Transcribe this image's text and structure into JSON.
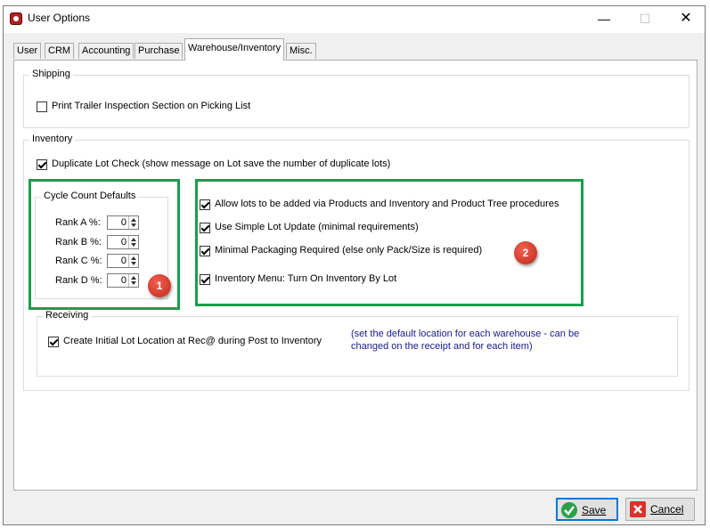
{
  "window": {
    "title": "User Options",
    "minimize_glyph": "—",
    "maximize_glyph": "☐",
    "close_glyph": "✕"
  },
  "tabs": [
    {
      "label": "User"
    },
    {
      "label": "CRM"
    },
    {
      "label": "Accounting"
    },
    {
      "label": "Purchase"
    },
    {
      "label": "Warehouse/Inventory"
    },
    {
      "label": "Misc."
    }
  ],
  "shipping": {
    "title": "Shipping",
    "print_trailer": {
      "label": "Print Trailer Inspection Section on Picking List",
      "checked": false
    }
  },
  "inventory": {
    "title": "Inventory",
    "duplicate_lot": {
      "label": "Duplicate Lot Check (show message on Lot save the number of duplicate lots)",
      "checked": true
    },
    "cycle_count": {
      "title": "Cycle Count Defaults",
      "ranks": [
        {
          "label": "Rank A %:",
          "value": "0"
        },
        {
          "label": "Rank B %:",
          "value": "0"
        },
        {
          "label": "Rank C %:",
          "value": "0"
        },
        {
          "label": "Rank D %:",
          "value": "0"
        }
      ]
    },
    "options": [
      {
        "label": "Allow lots to be added via Products and Inventory and Product Tree procedures",
        "checked": true
      },
      {
        "label": "Use Simple Lot Update (minimal requirements)",
        "checked": true
      },
      {
        "label": "Minimal Packaging Required (else only Pack/Size is required)",
        "checked": true
      },
      {
        "label": "Inventory Menu: Turn On Inventory By Lot",
        "checked": true
      }
    ],
    "receiving": {
      "title": "Receiving",
      "initial_lot": {
        "label": "Create Initial Lot Location at Rec@ during Post to Inventory",
        "checked": true
      },
      "note_line1": "(set the default location for each warehouse - can be",
      "note_line2": "changed on the receipt and for each item)"
    }
  },
  "annotations": {
    "badge1": "1",
    "badge2": "2",
    "highlight_color": "#1a9e4b"
  },
  "buttons": {
    "save": "Save",
    "cancel": "Cancel"
  },
  "colors": {
    "accent": "#0078d7",
    "note_text": "#1a1a8c"
  }
}
